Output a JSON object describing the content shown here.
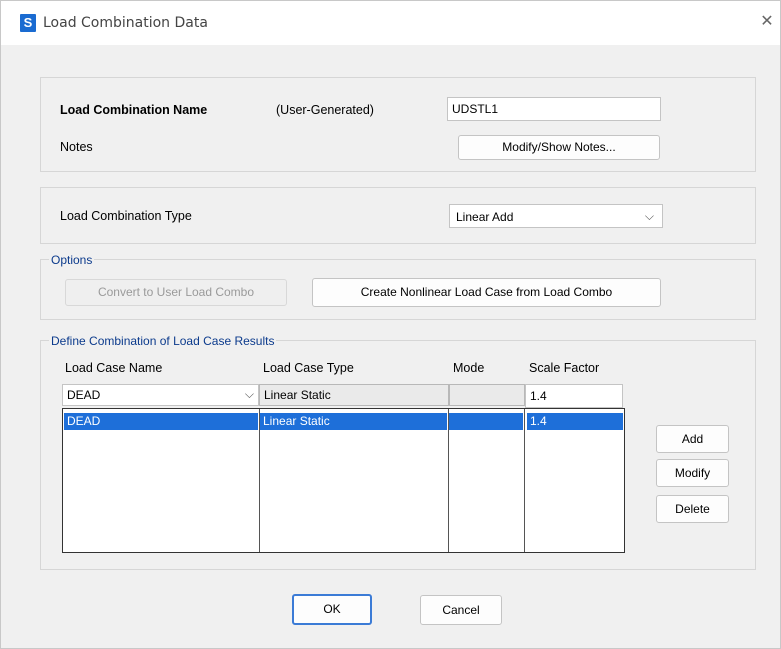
{
  "window": {
    "app_icon_letter": "S",
    "title": "Load Combination Data",
    "close_glyph": "✕"
  },
  "name_section": {
    "name_label": "Load Combination Name",
    "generated_label": "(User-Generated)",
    "name_value": "UDSTL1",
    "notes_label": "Notes",
    "notes_button": "Modify/Show Notes..."
  },
  "type_section": {
    "type_label": "Load Combination Type",
    "type_value": "Linear Add"
  },
  "options": {
    "legend": "Options",
    "convert_button": "Convert to User Load Combo",
    "create_button": "Create Nonlinear Load Case from Load Combo"
  },
  "define": {
    "legend": "Define Combination of Load Case Results",
    "headers": {
      "case_name": "Load Case Name",
      "case_type": "Load Case Type",
      "mode": "Mode",
      "scale": "Scale Factor"
    },
    "input_row": {
      "case_name": "DEAD",
      "case_type": "Linear Static",
      "mode": "",
      "scale": "1.4"
    },
    "rows": [
      {
        "case_name": "DEAD",
        "case_type": "Linear Static",
        "mode": "",
        "scale": "1.4"
      }
    ],
    "add_button": "Add",
    "modify_button": "Modify",
    "delete_button": "Delete"
  },
  "footer": {
    "ok_button": "OK",
    "cancel_button": "Cancel"
  },
  "colors": {
    "selection": "#1e6fd9",
    "legend_text": "#0b3a8c",
    "app_icon": "#1a6bd1"
  }
}
